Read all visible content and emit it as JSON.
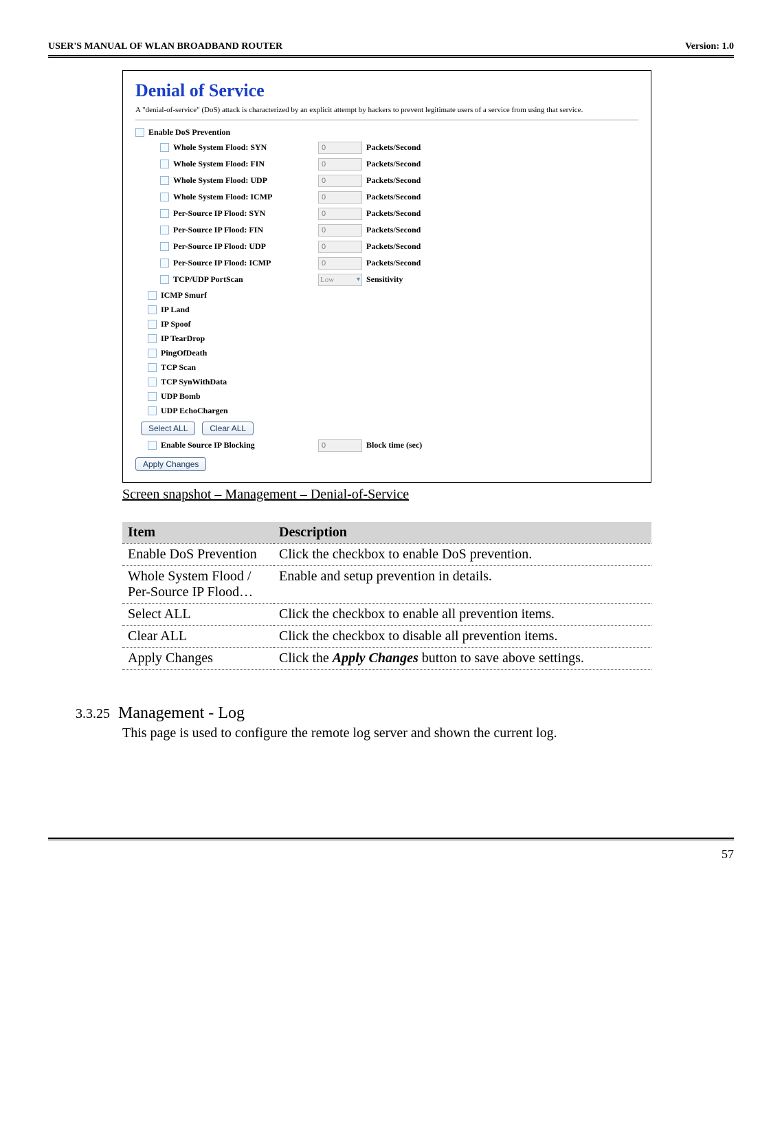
{
  "header": {
    "left": "USER'S MANUAL OF WLAN BROADBAND ROUTER",
    "right": "Version: 1.0"
  },
  "dos": {
    "title": "Denial of Service",
    "desc": "A \"denial-of-service\" (DoS) attack is characterized by an explicit attempt by hackers to prevent legitimate users of a service from using that service.",
    "enable_label": "Enable DoS Prevention",
    "pkts_unit": "Packets/Second",
    "sens_unit": "Sensitivity",
    "block_label": "Enable Source IP Blocking",
    "block_unit": "Block time (sec)",
    "block_value": "0",
    "select_all": "Select ALL",
    "clear_all": "Clear ALL",
    "apply": "Apply Changes",
    "sens_value": "Low",
    "items_with_val": [
      {
        "label": "Whole System Flood: SYN",
        "val": "0"
      },
      {
        "label": "Whole System Flood: FIN",
        "val": "0"
      },
      {
        "label": "Whole System Flood: UDP",
        "val": "0"
      },
      {
        "label": "Whole System Flood: ICMP",
        "val": "0"
      },
      {
        "label": "Per-Source IP Flood: SYN",
        "val": "0"
      },
      {
        "label": "Per-Source IP Flood: FIN",
        "val": "0"
      },
      {
        "label": "Per-Source IP Flood: UDP",
        "val": "0"
      },
      {
        "label": "Per-Source IP Flood: ICMP",
        "val": "0"
      }
    ],
    "portscan_label": "TCP/UDP PortScan",
    "items_simple": [
      "ICMP Smurf",
      "IP Land",
      "IP Spoof",
      "IP TearDrop",
      "PingOfDeath",
      "TCP Scan",
      "TCP SynWithData",
      "UDP Bomb",
      "UDP EchoChargen"
    ]
  },
  "caption": "Screen snapshot – Management – Denial-of-Service",
  "table": {
    "h1": "Item",
    "h2": "Description",
    "rows": [
      {
        "c1": "Enable DoS Prevention",
        "c2": "Click the checkbox to enable DoS prevention."
      },
      {
        "c1": "Whole System Flood / Per-Source IP Flood…",
        "c2": "Enable and setup prevention in details."
      },
      {
        "c1": "Select ALL",
        "c2": "Click the checkbox to enable all prevention items."
      },
      {
        "c1": "Clear ALL",
        "c2": "Click the checkbox to disable all prevention items."
      }
    ],
    "apply_row": {
      "c1": "Apply Changes",
      "c2a": "Click the ",
      "c2b": "Apply Changes",
      "c2c": " button to save above settings."
    }
  },
  "section": {
    "num": "3.3.25",
    "title": "Management - Log",
    "body": "This page is used to configure the remote log server and shown the current log."
  },
  "page_number": "57"
}
